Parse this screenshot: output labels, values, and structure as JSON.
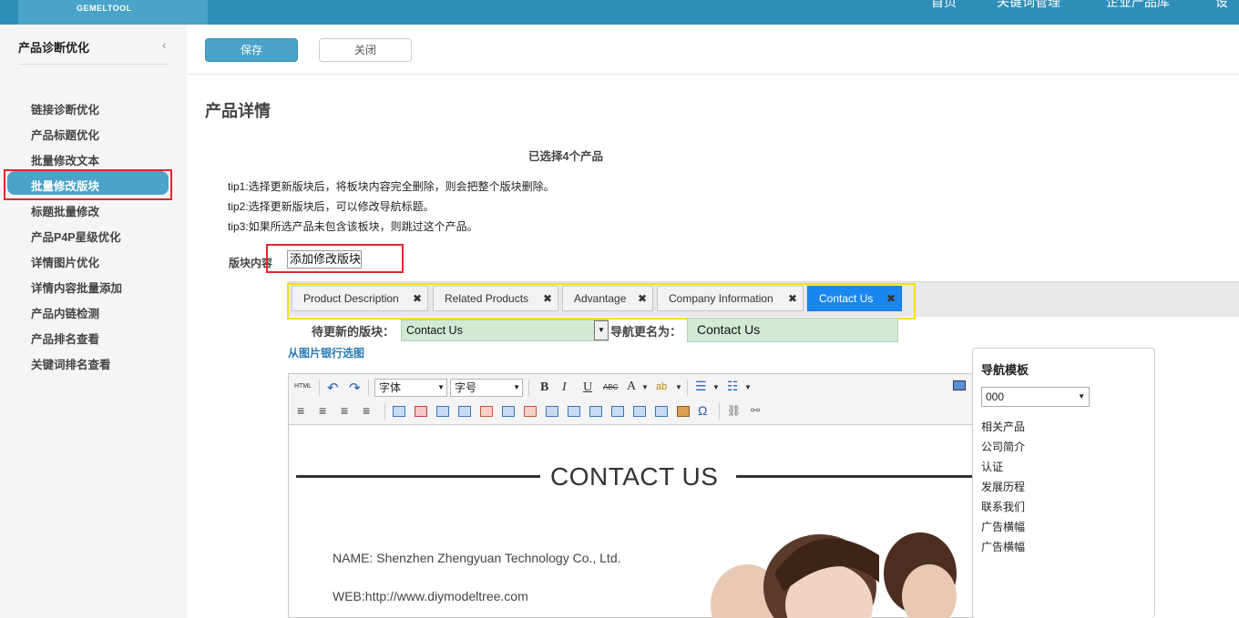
{
  "header": {
    "logo_text": "GEMELTOOL",
    "nav": [
      "首页",
      "关键词管理",
      "企业产品库",
      "设"
    ]
  },
  "sidebar": {
    "title": "产品诊断优化",
    "items": [
      {
        "label": "链接诊断优化"
      },
      {
        "label": "产品标题优化"
      },
      {
        "label": "批量修改文本"
      },
      {
        "label": "批量修改版块",
        "active": true
      },
      {
        "label": "标题批量修改"
      },
      {
        "label": "产品P4P星级优化"
      },
      {
        "label": "详情图片优化"
      },
      {
        "label": "详情内容批量添加"
      },
      {
        "label": "产品内链检测"
      },
      {
        "label": "产品排名查看"
      },
      {
        "label": "关键词排名查看"
      }
    ]
  },
  "actions": {
    "save_label": "保存",
    "close_label": "关闭"
  },
  "main": {
    "page_title": "产品详情",
    "selected_count": "已选择4个产品",
    "tips": [
      "tip1:选择更新版块后，将板块内容完全删除，则会把整个版块删除。",
      "tip2:选择更新版块后，可以修改导航标题。",
      "tip3:如果所选产品未包含该板块，则跳过这个产品。"
    ],
    "block_label": "版块内容",
    "add_block_button": "添加修改版块",
    "tabs": [
      {
        "label": "Product Description",
        "active": false
      },
      {
        "label": "Related Products",
        "active": false
      },
      {
        "label": "Advantage",
        "active": false
      },
      {
        "label": "Company Information",
        "active": false
      },
      {
        "label": "Contact Us",
        "active": true
      }
    ],
    "pending_block_label": "待更新的版块：",
    "pending_block_value": "Contact Us",
    "rename_label": "导航更名为：",
    "rename_value": "Contact Us",
    "image_bank_link": "从图片银行选图"
  },
  "editor": {
    "toolbar": {
      "html_label": "HTML",
      "font_family": "字体",
      "font_size": "字号",
      "bold": "B",
      "italic": "I",
      "underline": "U",
      "strike": "ABC",
      "font_color": "A",
      "omega": "Ω"
    },
    "content": {
      "heading": "CONTACT US",
      "name_line": "NAME: Shenzhen Zhengyuan Technology Co., Ltd.",
      "web_line": "WEB:http://www.diymodeltree.com"
    }
  },
  "nav_template": {
    "title": "导航模板",
    "selected": "000",
    "items": [
      "相关产品",
      "公司简介",
      "认证",
      "发展历程",
      "联系我们",
      "广告横幅",
      "广告横幅"
    ]
  },
  "colors": {
    "topbar": "#2e8eb8",
    "accent": "#4aa3c8",
    "active_tab": "#1a87f0",
    "highlight_red": "#e0282e",
    "highlight_yellow": "#f6e000",
    "select_green": "#d2e9d4"
  }
}
